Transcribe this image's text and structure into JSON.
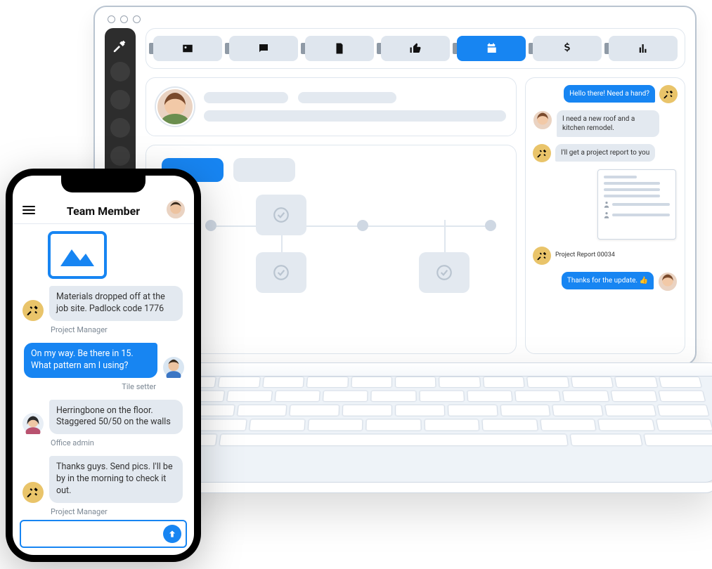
{
  "phone": {
    "title": "Team Member",
    "messages": {
      "m1_text": "Materials dropped off at the job site. Padlock code 1776",
      "m1_sender": "Project Manager",
      "m2_text": "On my way. Be there in 15. What pattern am I using?",
      "m2_sender": "Tile setter",
      "m3_text": "Herringbone on the floor. Staggered 50/50 on the walls",
      "m3_sender": "Office admin",
      "m4_text": "Thanks guys. Send pics. I'll be by in the morning to check it out.",
      "m4_sender": "Project Manager"
    },
    "input_placeholder": ""
  },
  "laptop": {
    "chat": {
      "c1": "Hello there! Need a hand?",
      "c2": "I need a new roof and a kitchen remodel.",
      "c3": "I'll get a project report to you",
      "report_label": "Project Report 00034",
      "c4": "Thanks for the update. 👍"
    }
  }
}
